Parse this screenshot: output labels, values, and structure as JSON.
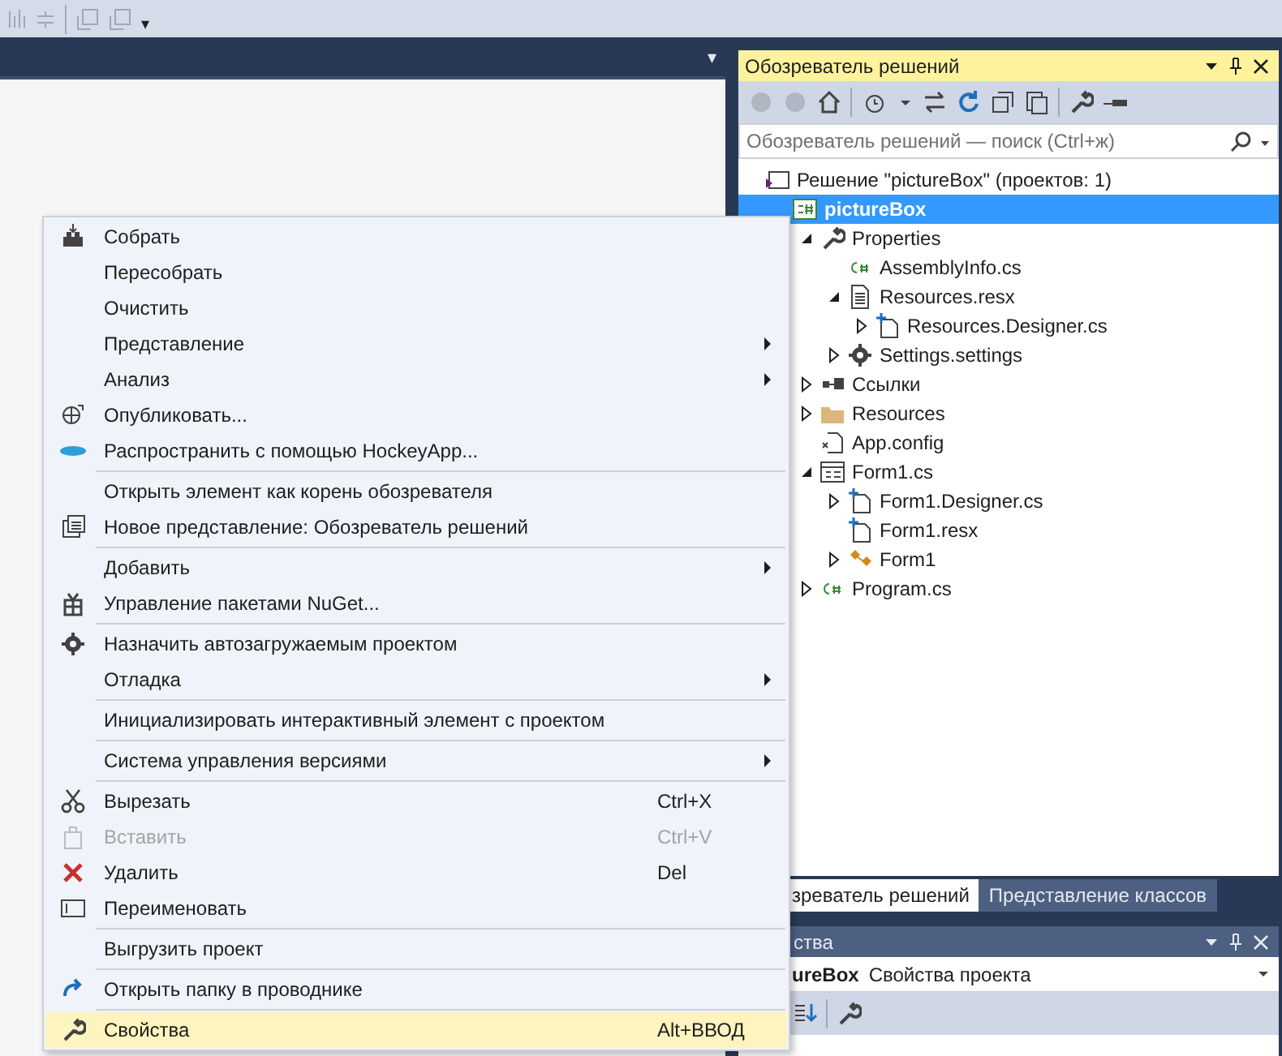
{
  "toolbar": {
    "overflow": "▾"
  },
  "document": {
    "menu_caret": "▾"
  },
  "solution_explorer": {
    "title": "Обозреватель решений",
    "search": {
      "placeholder": "Обозреватель решений — поиск (Ctrl+ж)"
    },
    "tree": [
      {
        "kind": "solution",
        "label": "Решение \"pictureBox\"  (проектов: 1)",
        "expander": false,
        "selected": false,
        "children": [
          {
            "kind": "project",
            "label": "pictureBox",
            "expander": false,
            "selected": true,
            "children": [
              {
                "kind": "properties",
                "label": "Properties",
                "expander": true,
                "expanded": true,
                "selected": false,
                "children": [
                  {
                    "kind": "csfile",
                    "label": "AssemblyInfo.cs",
                    "expander": false,
                    "selected": false
                  },
                  {
                    "kind": "resx",
                    "label": "Resources.resx",
                    "expander": true,
                    "expanded": true,
                    "selected": false,
                    "children": [
                      {
                        "kind": "designer",
                        "label": "Resources.Designer.cs",
                        "expander": true,
                        "expanded": false,
                        "selected": false
                      }
                    ]
                  },
                  {
                    "kind": "settings",
                    "label": "Settings.settings",
                    "expander": true,
                    "expanded": false,
                    "selected": false
                  }
                ]
              },
              {
                "kind": "references",
                "label": "Ссылки",
                "expander": true,
                "expanded": false,
                "selected": false
              },
              {
                "kind": "folder",
                "label": "Resources",
                "expander": true,
                "expanded": false,
                "selected": false
              },
              {
                "kind": "config",
                "label": "App.config",
                "expander": false,
                "selected": false
              },
              {
                "kind": "form",
                "label": "Form1.cs",
                "expander": true,
                "expanded": true,
                "selected": false,
                "children": [
                  {
                    "kind": "designer",
                    "label": "Form1.Designer.cs",
                    "expander": true,
                    "expanded": false,
                    "selected": false
                  },
                  {
                    "kind": "designer",
                    "label": "Form1.resx",
                    "expander": false,
                    "selected": false
                  },
                  {
                    "kind": "class",
                    "label": "Form1",
                    "expander": true,
                    "expanded": false,
                    "selected": false
                  }
                ]
              },
              {
                "kind": "csfile",
                "label": "Program.cs",
                "expander": true,
                "expanded": false,
                "selected": false
              }
            ]
          }
        ]
      }
    ]
  },
  "tabs": [
    {
      "label": "зреватель решений",
      "selected": true
    },
    {
      "label": "Представление классов",
      "selected": false
    }
  ],
  "properties": {
    "title": "ства",
    "object_name": "ureBox",
    "object_type": "Свойства проекта"
  },
  "context_menu": [
    {
      "kind": "item",
      "label": "Собрать",
      "submenu": false,
      "disabled": false,
      "selected": false
    },
    {
      "kind": "item",
      "label": "Пересобрать",
      "submenu": false,
      "disabled": false,
      "selected": false
    },
    {
      "kind": "item",
      "label": "Очистить",
      "submenu": false,
      "disabled": false,
      "selected": false
    },
    {
      "kind": "item",
      "label": "Представление",
      "submenu": true,
      "disabled": false,
      "selected": false
    },
    {
      "kind": "item",
      "label": "Анализ",
      "submenu": true,
      "disabled": false,
      "selected": false
    },
    {
      "kind": "item",
      "label": "Опубликовать...",
      "submenu": false,
      "disabled": false,
      "selected": false
    },
    {
      "kind": "item",
      "label": "Распространить с помощью HockeyApp...",
      "submenu": false,
      "disabled": false,
      "selected": false
    },
    {
      "kind": "separator"
    },
    {
      "kind": "item",
      "label": "Открыть элемент как корень обозревателя",
      "submenu": false,
      "disabled": false,
      "selected": false
    },
    {
      "kind": "item",
      "label": "Новое представление: Обозреватель решений",
      "submenu": false,
      "disabled": false,
      "selected": false
    },
    {
      "kind": "separator"
    },
    {
      "kind": "item",
      "label": "Добавить",
      "submenu": true,
      "disabled": false,
      "selected": false
    },
    {
      "kind": "item",
      "label": "Управление пакетами NuGet...",
      "submenu": false,
      "disabled": false,
      "selected": false
    },
    {
      "kind": "separator"
    },
    {
      "kind": "item",
      "label": "Назначить автозагружаемым проектом",
      "submenu": false,
      "disabled": false,
      "selected": false
    },
    {
      "kind": "item",
      "label": "Отладка",
      "submenu": true,
      "disabled": false,
      "selected": false
    },
    {
      "kind": "separator"
    },
    {
      "kind": "item",
      "label": "Инициализировать интерактивный элемент с проектом",
      "submenu": false,
      "disabled": false,
      "selected": false
    },
    {
      "kind": "separator"
    },
    {
      "kind": "item",
      "label": "Система управления версиями",
      "submenu": true,
      "disabled": false,
      "selected": false
    },
    {
      "kind": "separator"
    },
    {
      "kind": "item",
      "label": "Вырезать",
      "shortcut": "Ctrl+X",
      "submenu": false,
      "disabled": false,
      "selected": false
    },
    {
      "kind": "item",
      "label": "Вставить",
      "shortcut": "Ctrl+V",
      "submenu": false,
      "disabled": true,
      "selected": false
    },
    {
      "kind": "item",
      "label": "Удалить",
      "shortcut": "Del",
      "submenu": false,
      "disabled": false,
      "selected": false
    },
    {
      "kind": "item",
      "label": "Переименовать",
      "submenu": false,
      "disabled": false,
      "selected": false
    },
    {
      "kind": "separator"
    },
    {
      "kind": "item",
      "label": "Выгрузить проект",
      "submenu": false,
      "disabled": false,
      "selected": false
    },
    {
      "kind": "separator"
    },
    {
      "kind": "item",
      "label": "Открыть папку в проводнике",
      "submenu": false,
      "disabled": false,
      "selected": false
    },
    {
      "kind": "separator"
    },
    {
      "kind": "item",
      "label": "Свойства",
      "shortcut": "Alt+ВВОД",
      "submenu": false,
      "disabled": false,
      "selected": true
    }
  ]
}
